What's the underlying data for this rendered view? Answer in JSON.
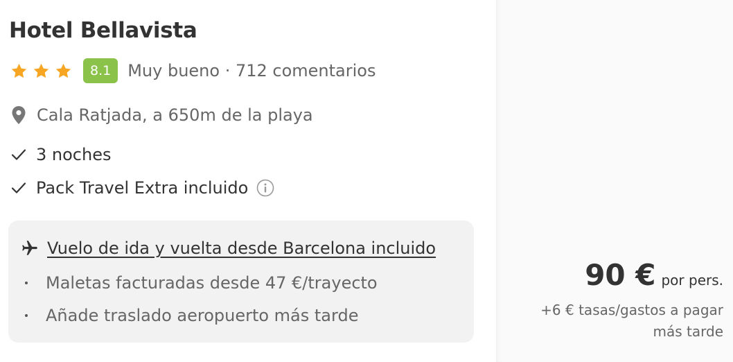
{
  "hotel": {
    "name": "Hotel Bellavista",
    "star_count": 3,
    "star_color": "#f6a623",
    "score": "8.1",
    "score_color": "#8bc34a",
    "review_summary": "Muy bueno · 712 comentarios",
    "location": "Cala Ratjada, a 650m de la playa",
    "features": [
      "3 noches",
      "Pack Travel Extra incluido"
    ]
  },
  "icons": {
    "star": "star-icon",
    "location": "location-pin-icon",
    "check": "check-icon",
    "info": "info-icon",
    "plane": "plane-icon"
  },
  "flight": {
    "title": "Vuelo de ida y vuelta desde Barcelona incluido",
    "bullets": [
      "Maletas facturadas desde 47 €/trayecto",
      "Añade traslado aeropuerto más tarde"
    ]
  },
  "price": {
    "amount": "90 €",
    "unit": "por pers.",
    "fees_line1": "+6 € tasas/gastos a pagar",
    "fees_line2": "más tarde"
  }
}
